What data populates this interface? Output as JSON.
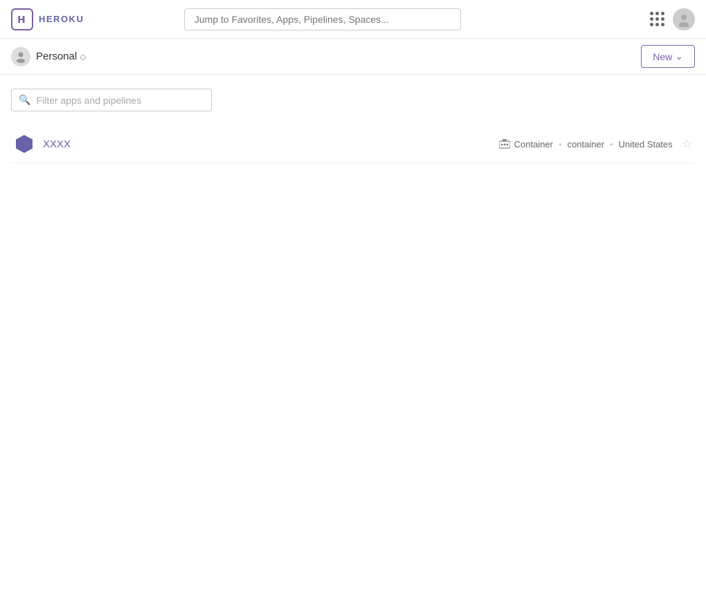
{
  "topNav": {
    "logoText": "HEROKU",
    "searchPlaceholder": "Jump to Favorites, Apps, Pipelines, Spaces...",
    "gridIconLabel": "apps-grid",
    "avatarLabel": "user-avatar"
  },
  "subNav": {
    "personalLabel": "Personal",
    "newButtonLabel": "New",
    "newButtonChevron": "⌄"
  },
  "filterSection": {
    "placeholder": "Filter apps and pipelines"
  },
  "appList": [
    {
      "name": "XXXX",
      "stackType": "Container",
      "stackName": "container",
      "region": "United States"
    }
  ]
}
